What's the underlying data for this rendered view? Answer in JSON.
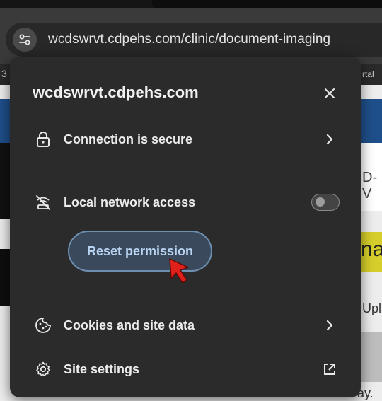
{
  "omnibox": {
    "url": "wcdswrvt.cdpehs.com/clinic/document-imaging",
    "site_info_icon": "tune-icon"
  },
  "background_page": {
    "bookmark_left": "3",
    "bookmark_right": "rtal",
    "side_text_1": "D-V",
    "side_text_2": "na",
    "side_text_3": "Upl",
    "side_text_4": "ay."
  },
  "popup": {
    "title": "wcdswrvt.cdpehs.com",
    "close_icon": "close-icon",
    "connection": {
      "label": "Connection is secure",
      "icon": "lock-icon"
    },
    "local_network": {
      "label": "Local network access",
      "icon": "network-off-icon",
      "enabled": false
    },
    "reset_button": {
      "label": "Reset permission"
    },
    "cookies": {
      "label": "Cookies and site data",
      "icon": "cookie-icon"
    },
    "site_settings": {
      "label": "Site settings",
      "icon": "gear-icon",
      "trailing_icon": "open-external-icon"
    }
  },
  "colors": {
    "popup_bg": "#2b2b2b",
    "button_bg": "#3a4a5c",
    "button_border": "#6d8fb0",
    "button_text": "#b9d4f2",
    "cursor": "#e0201b"
  }
}
